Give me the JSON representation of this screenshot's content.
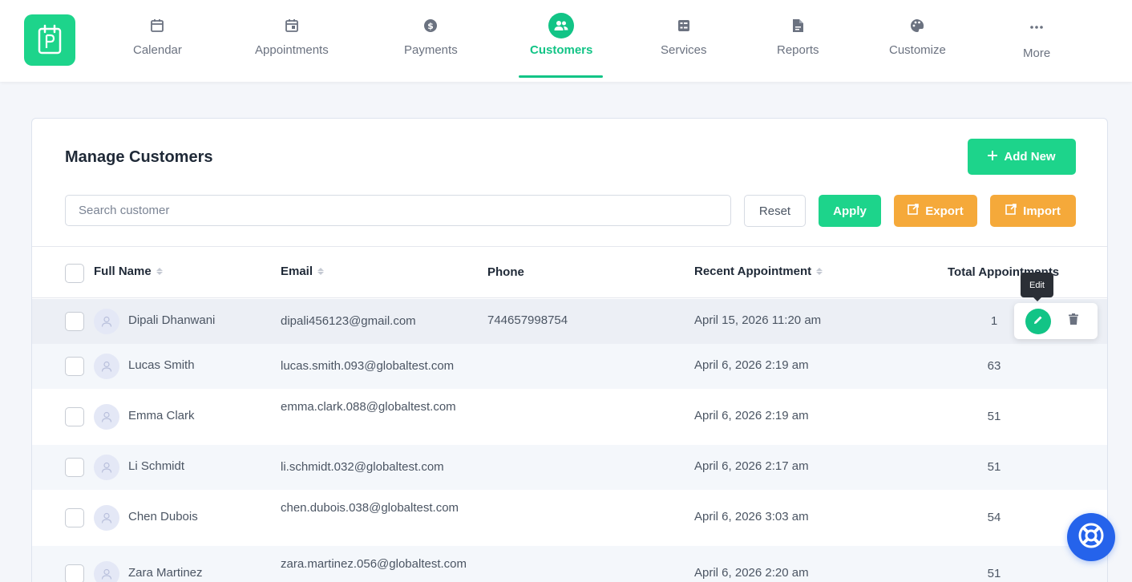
{
  "nav": {
    "items": [
      {
        "label": "Calendar",
        "icon": "calendar-icon"
      },
      {
        "label": "Appointments",
        "icon": "calendar-event-icon"
      },
      {
        "label": "Payments",
        "icon": "dollar-icon"
      },
      {
        "label": "Customers",
        "icon": "users-icon",
        "active": true
      },
      {
        "label": "Services",
        "icon": "services-icon"
      },
      {
        "label": "Reports",
        "icon": "file-icon"
      },
      {
        "label": "Customize",
        "icon": "palette-icon"
      },
      {
        "label": "More",
        "icon": "more-icon"
      }
    ]
  },
  "page": {
    "title": "Manage Customers",
    "add_label": "Add New",
    "search_placeholder": "Search customer",
    "reset_label": "Reset",
    "apply_label": "Apply",
    "export_label": "Export",
    "import_label": "Import"
  },
  "table": {
    "headers": {
      "name": "Full Name",
      "email": "Email",
      "phone": "Phone",
      "recent": "Recent Appointment",
      "total": "Total Appointments"
    },
    "rows": [
      {
        "name": "Dipali Dhanwani",
        "email": "dipali456123@gmail.com",
        "phone": "744657998754",
        "recent": "April 15, 2026 11:20 am",
        "total": "1"
      },
      {
        "name": "Lucas Smith",
        "email": "lucas.smith.093@globaltest.com",
        "phone": "",
        "recent": "April 6, 2026 2:19 am",
        "total": "63"
      },
      {
        "name": "Emma Clark",
        "email": "emma.clark.088@globaltest.com",
        "phone": "",
        "recent": "April 6, 2026 2:19 am",
        "total": "51"
      },
      {
        "name": "Li Schmidt",
        "email": "li.schmidt.032@globaltest.com",
        "phone": "",
        "recent": "April 6, 2026 2:17 am",
        "total": "51"
      },
      {
        "name": "Chen Dubois",
        "email": "chen.dubois.038@globaltest.com",
        "phone": "",
        "recent": "April 6, 2026 3:03 am",
        "total": "54"
      },
      {
        "name": "Zara Martinez",
        "email": "zara.martinez.056@globaltest.com",
        "phone": "",
        "recent": "April 6, 2026 2:20 am",
        "total": "51"
      }
    ]
  },
  "tooltip": {
    "edit": "Edit"
  },
  "colors": {
    "primary": "#12c486",
    "accent": "#f5a93a",
    "help": "#2563eb"
  }
}
